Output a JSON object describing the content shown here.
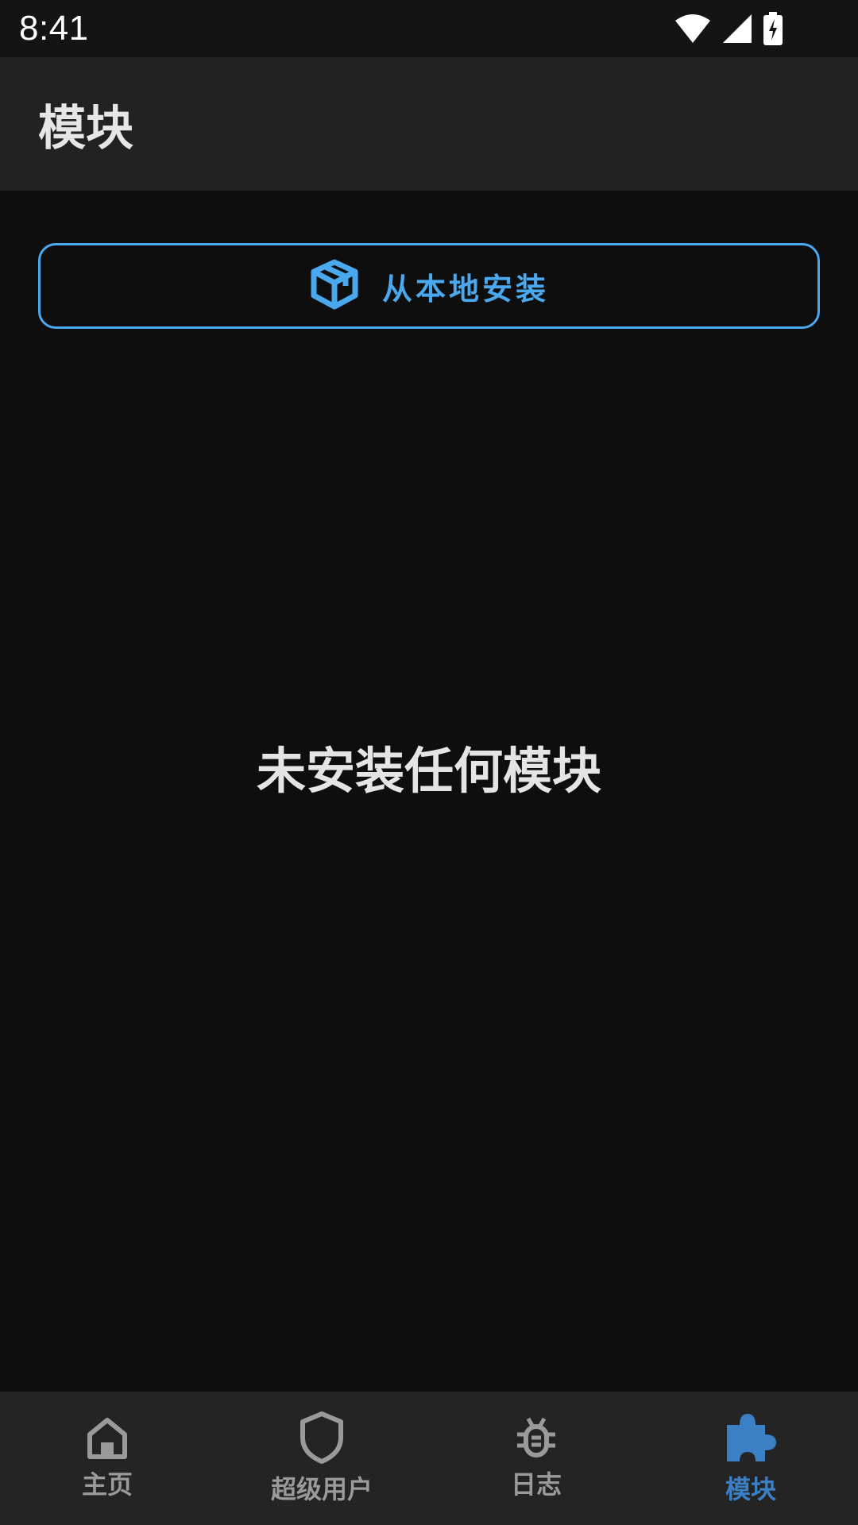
{
  "status_bar": {
    "time": "8:41",
    "icons": [
      "wifi-icon",
      "cell-signal-icon",
      "battery-charging-icon"
    ]
  },
  "app_bar": {
    "title": "模块"
  },
  "install_button": {
    "label": "从本地安装",
    "icon": "package-icon"
  },
  "empty_state": {
    "message": "未安装任何模块"
  },
  "bottom_nav": {
    "items": [
      {
        "label": "主页",
        "icon": "home-icon",
        "active": false
      },
      {
        "label": "超级用户",
        "icon": "shield-icon",
        "active": false
      },
      {
        "label": "日志",
        "icon": "bug-icon",
        "active": false
      },
      {
        "label": "模块",
        "icon": "puzzle-icon",
        "active": true
      }
    ]
  },
  "colors": {
    "accent": "#4aa8ee",
    "active_nav": "#3b7fc4",
    "background": "#0e0e0e",
    "app_bar": "#222222",
    "bottom_nav": "#242424",
    "inactive": "#9a9a9a"
  }
}
